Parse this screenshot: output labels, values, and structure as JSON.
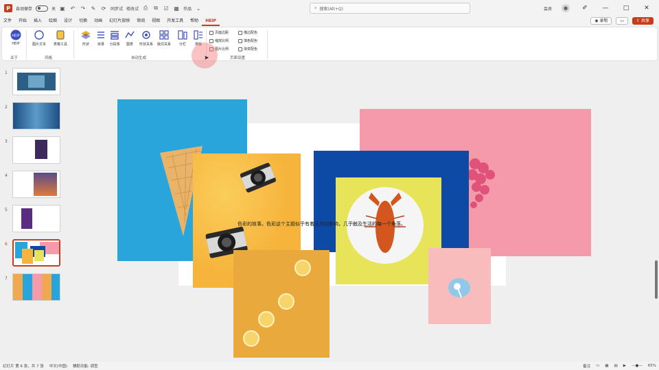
{
  "titlebar": {
    "autosave_label": "自动保存",
    "autosave_state": "关",
    "qa_text_1": "同步试",
    "qa_text_2": "修改试",
    "doc_name": "作品",
    "search_placeholder": "搜索(Alt+Q)",
    "user": "会员",
    "minimize": "—",
    "restore": "□",
    "close": "✕"
  },
  "menu": {
    "tabs": [
      "文件",
      "开始",
      "插入",
      "绘图",
      "设计",
      "切换",
      "动画",
      "幻灯片放映",
      "审阅",
      "视图",
      "开发工具",
      "帮助",
      "HEIP"
    ],
    "active_tab": "HEIP",
    "record": "录制",
    "share": "共享"
  },
  "ribbon": {
    "buttons": [
      {
        "label": "HEIP",
        "icon": "heip-logo-icon"
      },
      {
        "label": "图片文本",
        "icon": "text-box-icon"
      },
      {
        "label": "表格工具",
        "icon": "table-tool-icon"
      },
      {
        "label": "形状",
        "icon": "layers-icon"
      },
      {
        "label": "目录",
        "icon": "list-icon"
      },
      {
        "label": "分段落",
        "icon": "paragraph-icon"
      },
      {
        "label": "图表",
        "icon": "chart-icon"
      },
      {
        "label": "形状关系",
        "icon": "relation-icon"
      },
      {
        "label": "版式关系",
        "icon": "grid-icon"
      },
      {
        "label": "分栏",
        "icon": "columns-icon"
      },
      {
        "label": "排版",
        "icon": "layout-icon"
      }
    ],
    "checkboxes": [
      "页面边距",
      "缩放比例",
      "图片比例",
      "描边配色",
      "填色配色",
      "渐变配色"
    ],
    "group_labels": [
      "关于",
      "风格",
      "自动生成",
      "页面设置"
    ]
  },
  "slides": [
    {
      "num": "1"
    },
    {
      "num": "2"
    },
    {
      "num": "3"
    },
    {
      "num": "4"
    },
    {
      "num": "5"
    },
    {
      "num": "6",
      "active": true
    },
    {
      "num": "7"
    }
  ],
  "slide": {
    "caption": "色彩的故事。色彩这个主题似乎有着无尽的影响，几乎触及生活的每一个角落。"
  },
  "statusbar": {
    "slide_info": "幻灯片 第 6 张，共 7 张",
    "language": "中文(中国)",
    "accessibility": "辅助功能: 调查",
    "notes": "备注",
    "zoom": "65%"
  },
  "colors": {
    "accent": "#c43e1c",
    "blue_bg": "#2aa5dc",
    "orange_bg": "#f6b43c",
    "navy_bg": "#0d4aa6",
    "yellow_bg": "#e8e45a",
    "pink_bg": "#f49aab"
  }
}
